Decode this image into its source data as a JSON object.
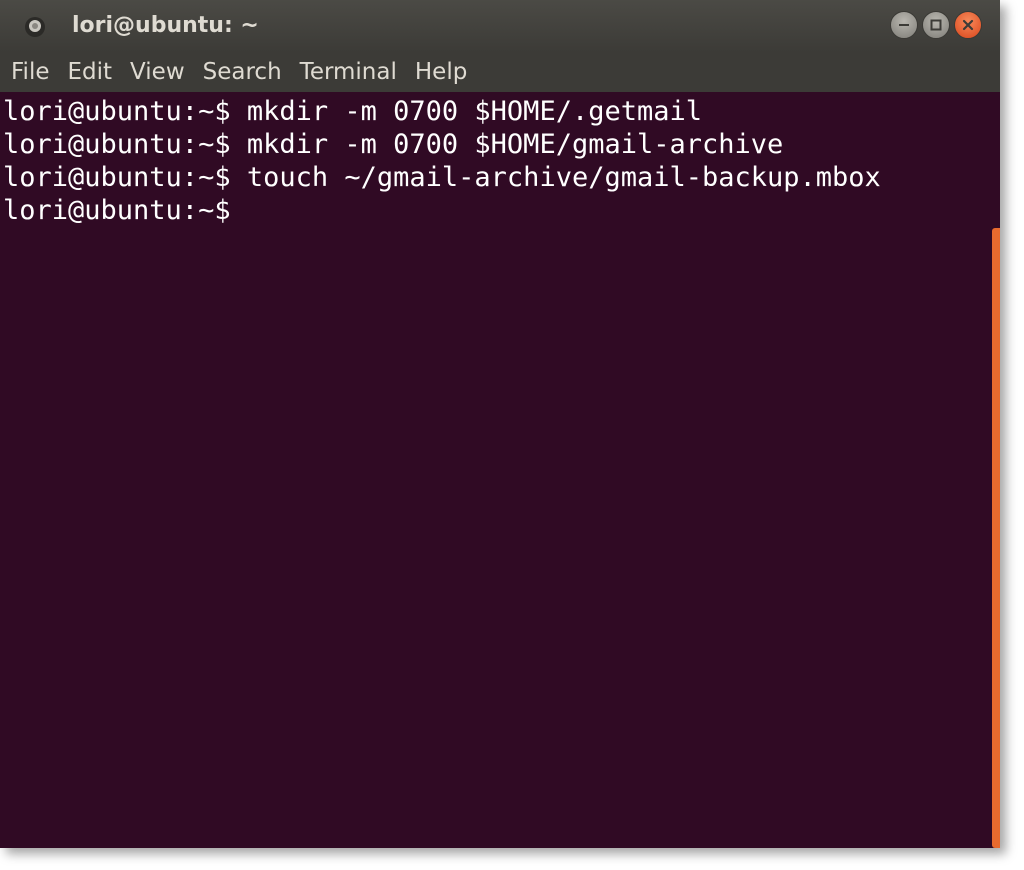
{
  "window": {
    "title": "lori@ubuntu: ~",
    "app_icon": "terminal-app-icon",
    "controls": [
      {
        "name": "minimize",
        "icon": "minimize-icon"
      },
      {
        "name": "maximize",
        "icon": "maximize-icon"
      },
      {
        "name": "close",
        "icon": "close-icon"
      }
    ]
  },
  "menu": {
    "items": [
      {
        "label": "File"
      },
      {
        "label": "Edit"
      },
      {
        "label": "View"
      },
      {
        "label": "Search"
      },
      {
        "label": "Terminal"
      },
      {
        "label": "Help"
      }
    ]
  },
  "terminal": {
    "lines": [
      {
        "prompt": "lori@ubuntu:~$",
        "command": "mkdir -m 0700 $HOME/.getmail"
      },
      {
        "prompt": "lori@ubuntu:~$",
        "command": "mkdir -m 0700 $HOME/gmail-archive"
      },
      {
        "prompt": "lori@ubuntu:~$",
        "command": "touch ~/gmail-archive/gmail-backup.mbox"
      },
      {
        "prompt": "lori@ubuntu:~$",
        "command": ""
      }
    ]
  },
  "colors": {
    "terminal_bg": "#300a24",
    "chrome_bg": "#3c3b37",
    "chrome_text": "#dfdbd2",
    "terminal_text": "#ffffff",
    "scrollbar_accent": "#e86a2e",
    "close_button": "#e3562a"
  }
}
